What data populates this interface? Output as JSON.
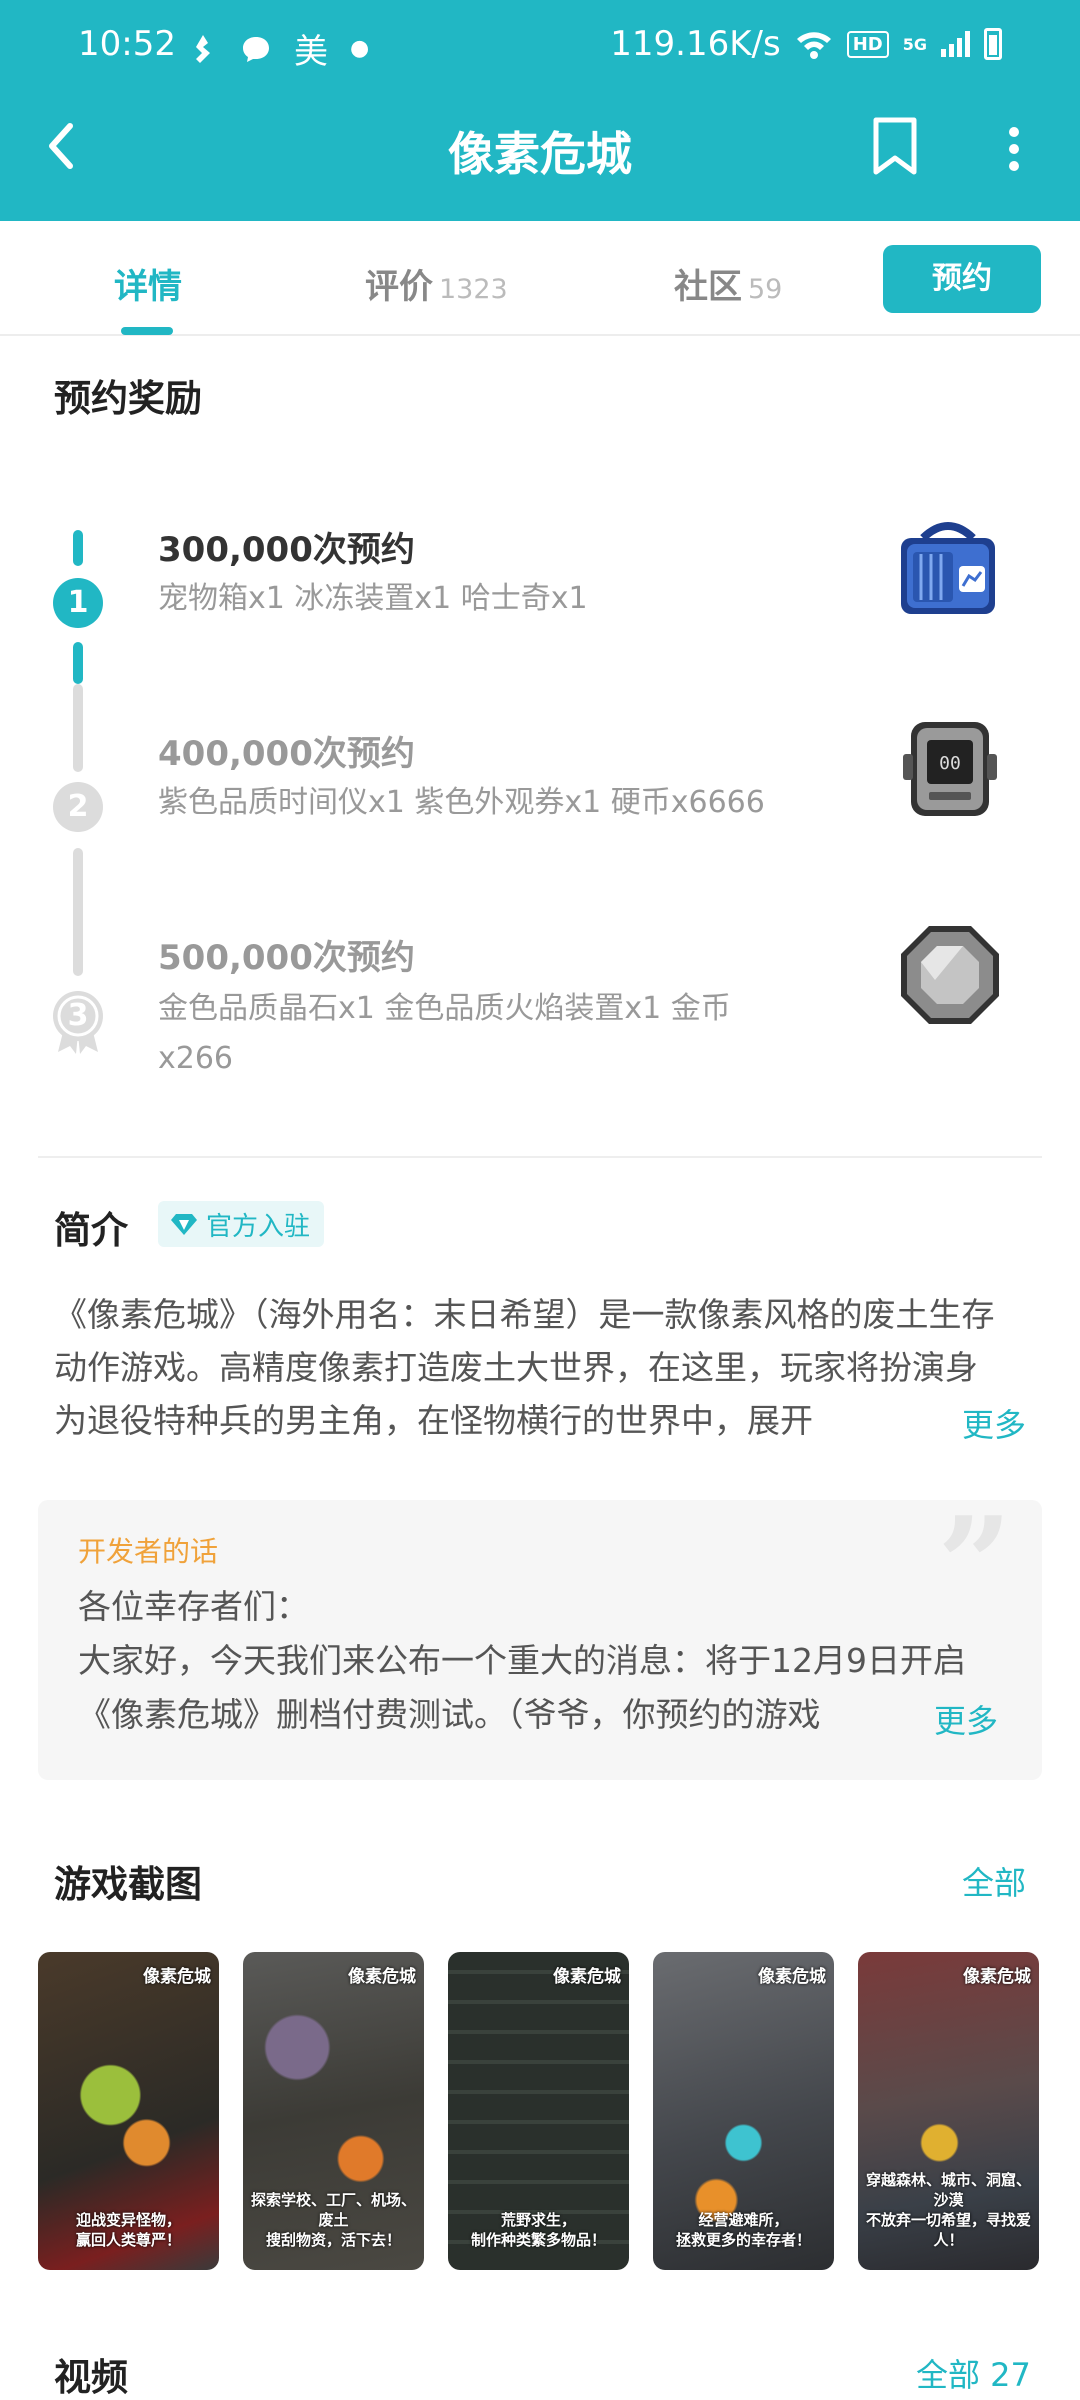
{
  "status_bar": {
    "time": "10:52",
    "left_text": "美",
    "net_speed": "119.16K/s",
    "hd_badge": "HD",
    "network": "5G"
  },
  "header": {
    "title": "像素危城"
  },
  "tabs": [
    {
      "label": "详情",
      "count": ""
    },
    {
      "label": "评价",
      "count": "1323"
    },
    {
      "label": "社区",
      "count": "59"
    }
  ],
  "reserve_button": "预约",
  "rewards": {
    "heading": "预约奖励",
    "items": [
      {
        "step": "1",
        "title": "300,000次预约",
        "desc": "宠物箱x1  冰冻装置x1 哈士奇x1",
        "icon": "pet-crate-icon"
      },
      {
        "step": "2",
        "title": "400,000次预约",
        "desc": "紫色品质时间仪x1   紫色外观券x1   硬币x6666",
        "icon": "time-device-icon"
      },
      {
        "step": "3",
        "title": "500,000次预约",
        "desc": "金色品质晶石x1  金色品质火焰装置x1  金币x266",
        "icon": "crystal-icon"
      }
    ]
  },
  "intro": {
    "heading": "简介",
    "badge": "官方入驻",
    "text": "《像素危城》（海外用名：末日希望）是一款像素风格的废土生存动作游戏。高精度像素打造废土大世界，在这里，玩家将扮演身为退役特种兵的男主角，在怪物横行的世界中，展开",
    "more": "更多"
  },
  "developer_note": {
    "label": "开发者的话",
    "text": "各位幸存者们：\n大家好，今天我们来公布一个重大的消息：将于12月9日开启《像素危城》删档付费测试。（爷爷，你预约的游戏",
    "more": "更多"
  },
  "screenshots": {
    "heading": "游戏截图",
    "all_link": "全部",
    "items": [
      {
        "logo": "像素危城",
        "caption": "迎战变异怪物，\n赢回人类尊严！"
      },
      {
        "logo": "像素危城",
        "caption": "探索学校、工厂、机场、废土\n搜刮物资，活下去！"
      },
      {
        "logo": "像素危城",
        "caption": "荒野求生，\n制作种类繁多物品！"
      },
      {
        "logo": "像素危城",
        "caption": "经营避难所，\n拯救更多的幸存者！"
      },
      {
        "logo": "像素危城",
        "caption": "穿越森林、城市、洞窟、沙漠\n不放弃一切希望，寻找爱人！"
      }
    ]
  },
  "videos": {
    "heading": "视频",
    "all_link": "全部 27"
  },
  "colors": {
    "accent": "#21b7c4",
    "dev_label": "#f0a23a",
    "muted": "#999999"
  }
}
